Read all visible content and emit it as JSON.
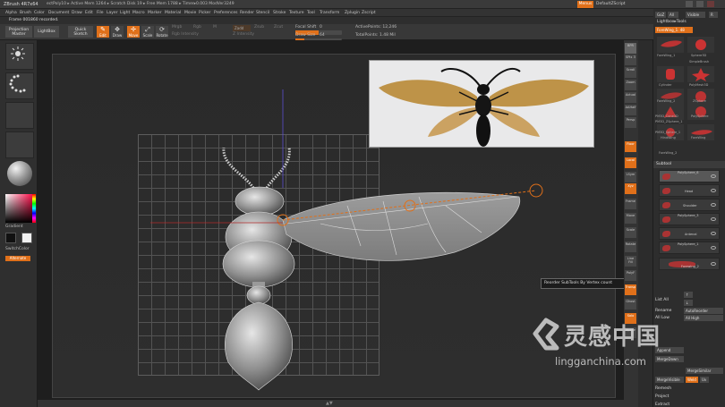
{
  "titlebar": {
    "app": "ZBrush 4R7x64",
    "stats": "ectPoly10 ▸ Active Mem 1264 ▸ Scratch Disk 19 ▸ Free Mem 1788 ▸ Timer▸0.003 ModVer3249",
    "menus_button": "Menus",
    "script_label": "DefaultZScript"
  },
  "menus": [
    "Alpha",
    "Brush",
    "Color",
    "Document",
    "Draw",
    "Edit",
    "File",
    "Layer",
    "Light",
    "Macro",
    "Marker",
    "Material",
    "Movie",
    "Picker",
    "Preferences",
    "Render",
    "Stencil",
    "Stroke",
    "Texture",
    "Tool",
    "Transform",
    "Zplugin",
    "Zscript"
  ],
  "note": "Frame 001860 recorded.",
  "toolbar": {
    "projection_master": "Projection Master",
    "lightbox": "LightBox",
    "quick_sketch": "Quick Sketch",
    "edit": "Edit",
    "draw": "Draw",
    "move": "Move",
    "scale": "Scale",
    "rotate": "Rotate",
    "mrgb": "Mrgb",
    "rgb": "Rgb",
    "m": "M",
    "zadd": "Zadd",
    "zsub": "Zsub",
    "zcut": "Zcut",
    "rgb_intensity": "Rgb Intensity",
    "z_intensity": "Z Intensity",
    "focal_shift_label": "Focal Shift",
    "focal_shift_value": "0",
    "draw_size_label": "Draw Size",
    "draw_size_value": "64",
    "active_points": "ActivePoints: 12,246",
    "total_points": "TotalPoints: 1.48 Mil",
    "focal_fill_pct": 50,
    "draw_fill_pct": 20
  },
  "leftshelf": {
    "gradient_label": "Gradient",
    "switchcolor_label": "SwitchColor",
    "alternate_label": "Alternate"
  },
  "canvas": {
    "tooltip": "Reorder SubTools By Vertex count"
  },
  "rightstrip": [
    "BPR",
    "SPix 3",
    "Scroll",
    "Zoom",
    "Actual",
    "AAHalf",
    "Persp",
    "Floor",
    "Local",
    "LSym",
    "Xyz",
    "Frame",
    "Move",
    "Scale",
    "Rotate",
    "Line Fill",
    "PolyF",
    "Transp",
    "Ghost",
    "Solo",
    "Xpose"
  ],
  "rightpanel": {
    "top_buttons": [
      "GoZ",
      "All",
      "Visible",
      "R"
    ],
    "lightbox_tools": "Lightbox▸Tools",
    "current_tool": "ForeWing_1. 48",
    "tools": [
      "ForeWing_1",
      "Sphere3D",
      "SimpleBrush",
      "Cylinder",
      "PolyMesh3D",
      "ForeWing_2",
      "ZSphere",
      "PM3D_Cone3D",
      "PM3D_ZSphere_1",
      "PolySphere",
      "PM3D_Sphere_1",
      "HindWing",
      "ForeWing",
      "ForeWing_2"
    ],
    "subtool_header": "Subtool",
    "subtools": [
      "PolySphere_6",
      "Head",
      "Shoulder",
      "PolySphere_3",
      "Antenal",
      "PolySphere_1",
      "Forewing_2"
    ],
    "list_all": "List All",
    "rename": "Rename",
    "autoreorder": "AutoReorder",
    "all_low": "All Low",
    "all_high": "All High",
    "append": "Append",
    "merge_down": "MergeDown",
    "merge_similar": "MergeSimilar",
    "merge_visible": "MergeVisible",
    "weld": "Weld",
    "uv": "Uv",
    "remesh": "Remesh",
    "project": "Project",
    "extract": "Extract"
  },
  "watermark": {
    "cn": "灵感中国",
    "en": "lingganchina.com"
  },
  "colors": {
    "accent": "#e0701a",
    "panel": "#2d2d2d",
    "canvas": "#2a2a2a"
  }
}
